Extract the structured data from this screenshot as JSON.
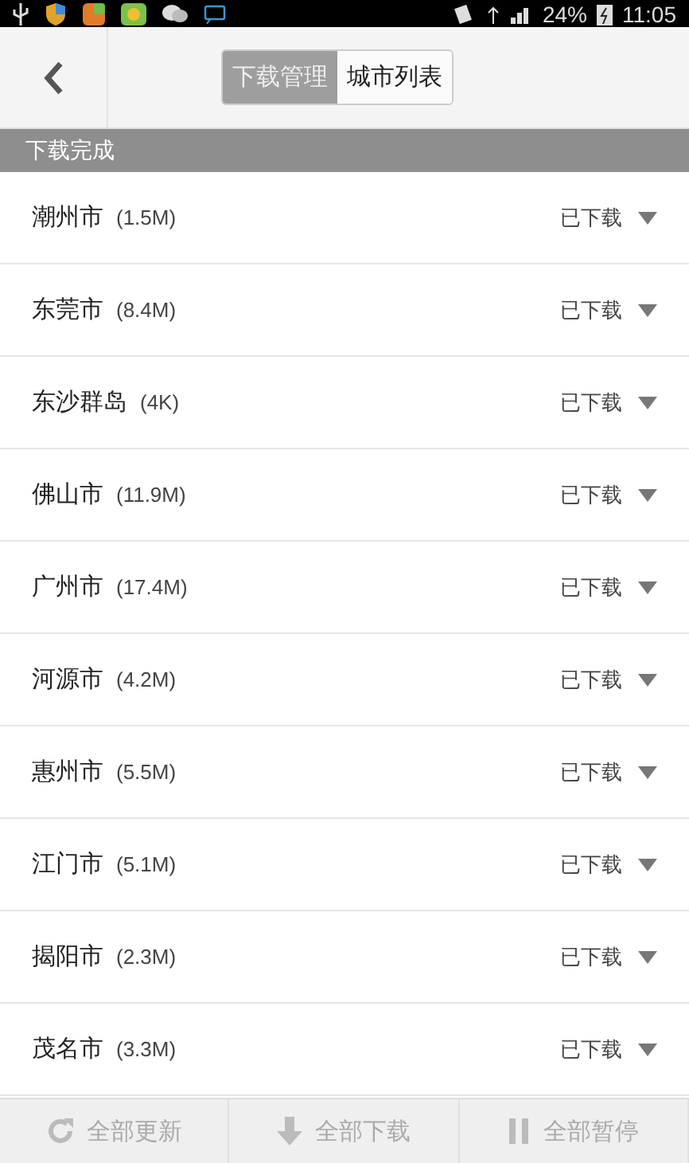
{
  "status_bar": {
    "battery": "24%",
    "time": "11:05"
  },
  "header": {
    "tabs": [
      {
        "label": "下载管理",
        "selected": true
      },
      {
        "label": "城市列表",
        "selected": false
      }
    ]
  },
  "section": {
    "title": "下载完成"
  },
  "cities": [
    {
      "name": "潮州市",
      "size": "(1.5M)",
      "status": "已下载"
    },
    {
      "name": "东莞市",
      "size": "(8.4M)",
      "status": "已下载"
    },
    {
      "name": "东沙群岛",
      "size": "(4K)",
      "status": "已下载"
    },
    {
      "name": "佛山市",
      "size": "(11.9M)",
      "status": "已下载"
    },
    {
      "name": "广州市",
      "size": "(17.4M)",
      "status": "已下载"
    },
    {
      "name": "河源市",
      "size": "(4.2M)",
      "status": "已下载"
    },
    {
      "name": "惠州市",
      "size": "(5.5M)",
      "status": "已下载"
    },
    {
      "name": "江门市",
      "size": "(5.1M)",
      "status": "已下载"
    },
    {
      "name": "揭阳市",
      "size": "(2.3M)",
      "status": "已下载"
    },
    {
      "name": "茂名市",
      "size": "(3.3M)",
      "status": "已下载"
    }
  ],
  "actions": [
    {
      "kind": "update",
      "label": "全部更新"
    },
    {
      "kind": "download",
      "label": "全部下载"
    },
    {
      "kind": "pause",
      "label": "全部暂停"
    }
  ]
}
